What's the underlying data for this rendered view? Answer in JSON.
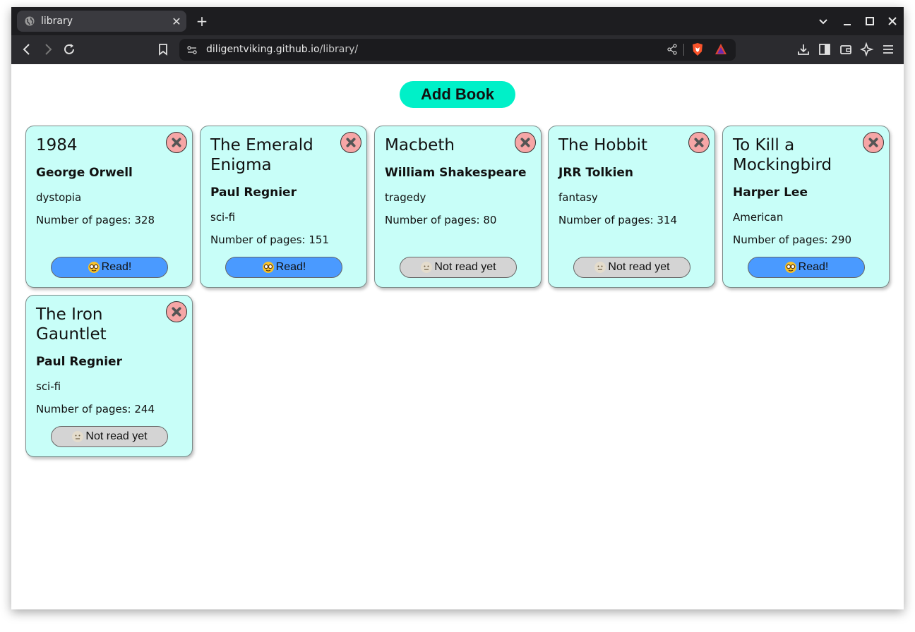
{
  "browser": {
    "tab_title": "library",
    "url_host": "diligentviking.github.io",
    "url_path": "/library/"
  },
  "page": {
    "add_book_label": "Add Book"
  },
  "books": [
    {
      "title": "1984",
      "author": "George Orwell",
      "genre": "dystopia",
      "pages": "Number of pages: 328",
      "status": "Read!",
      "read": true
    },
    {
      "title": "The Emerald Enigma",
      "author": "Paul Regnier",
      "genre": "sci-fi",
      "pages": "Number of pages: 151",
      "status": "Read!",
      "read": true
    },
    {
      "title": "Macbeth",
      "author": "William Shakespeare",
      "genre": "tragedy",
      "pages": "Number of pages: 80",
      "status": "Not read yet",
      "read": false
    },
    {
      "title": "The Hobbit",
      "author": "JRR Tolkien",
      "genre": "fantasy",
      "pages": "Number of pages: 314",
      "status": "Not read yet",
      "read": false
    },
    {
      "title": "To Kill a Mockingbird",
      "author": "Harper Lee",
      "genre": "American",
      "pages": "Number of pages: 290",
      "status": "Read!",
      "read": true
    },
    {
      "title": "The Iron Gauntlet",
      "author": "Paul Regnier",
      "genre": "sci-fi",
      "pages": "Number of pages: 244",
      "status": "Not read yet",
      "read": false
    }
  ],
  "colors": {
    "card_bg": "#c8fef8",
    "add_button": "#00f0c8",
    "read_button": "#4a9aff",
    "unread_button": "#d4d4d4",
    "remove_button": "#f6a6a6"
  }
}
